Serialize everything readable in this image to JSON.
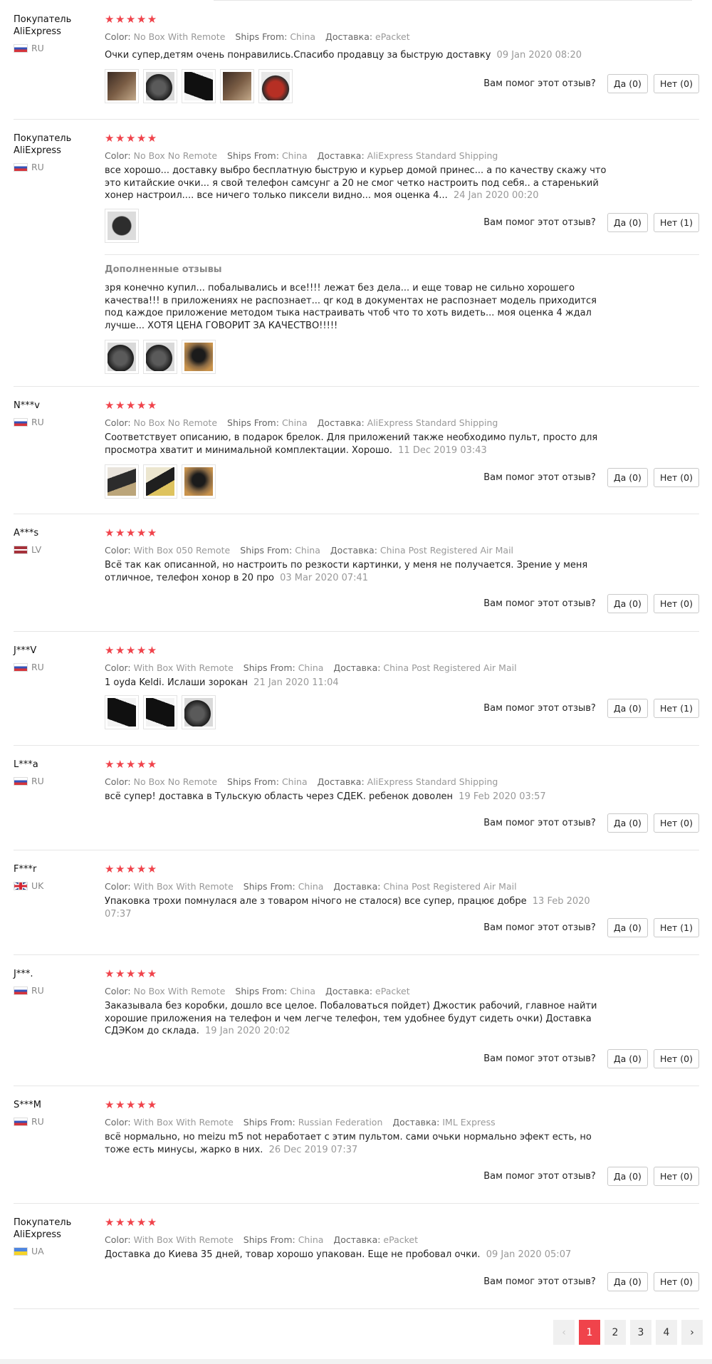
{
  "helpful_question": "Вам помог этот отзыв?",
  "labels": {
    "color": "Color:",
    "ships_from": "Ships From:",
    "delivery": "Доставка:"
  },
  "stars": "★★★★★",
  "reviews": [
    {
      "buyer": "Покупатель AliExpress",
      "country": "RU",
      "color": "No Box With Remote",
      "ships_from": "China",
      "delivery": "ePacket",
      "text": "Очки супер,детям очень понравились.Спасибо продавцу за быструю доставку",
      "date": "09 Jan 2020 08:20",
      "yes": "Да (0)",
      "no": "Нет (0)"
    },
    {
      "buyer": "Покупатель AliExpress",
      "country": "RU",
      "color": "No Box No Remote",
      "ships_from": "China",
      "delivery": "AliExpress Standard Shipping",
      "text": "все хорошо... доставку выбро бесплатную быструю и курьер домой принес... а по качеству скажу что это китайские очки... я свой телефон самсунг а 20 не смог четко настроить под себя.. а старенький хонер настроил.... все ничего только пиксели видно... моя оценка 4...",
      "date": "24 Jan 2020 00:20",
      "yes": "Да (0)",
      "no": "Нет (1)",
      "additional_title": "Дополненные отзывы",
      "additional_text": "зря конечно купил... побалывались и все!!!! лежат без дела... и еще товар не сильно хорошего качества!!! в приложениях не распознает... qr код в документах не распознает модель приходится под каждое приложение методом тыка настраивать чтоб что то хоть видеть... моя оценка 4 ждал лучше... ХОТЯ ЦЕНА ГОВОРИТ ЗА КАЧЕСТВО!!!!!"
    },
    {
      "buyer": "N***v",
      "country": "RU",
      "color": "No Box No Remote",
      "ships_from": "China",
      "delivery": "AliExpress Standard Shipping",
      "text": "Соответствует описанию, в подарок брелок. Для приложений также необходимо пульт, просто для просмотра хватит и минимальной комплектации. Хорошо.",
      "date": "11 Dec 2019 03:43",
      "yes": "Да (0)",
      "no": "Нет (0)"
    },
    {
      "buyer": "A***s",
      "country": "LV",
      "color": "With Box 050 Remote",
      "ships_from": "China",
      "delivery": "China Post Registered Air Mail",
      "text": "Всё так как описанной, но настроить по резкости картинки, у меня не получается. Зрение у меня отличное, телефон хонор в 20 про",
      "date": "03 Mar 2020 07:41",
      "yes": "Да (0)",
      "no": "Нет (0)"
    },
    {
      "buyer": "J***V",
      "country": "RU",
      "color": "With Box With Remote",
      "ships_from": "China",
      "delivery": "China Post Registered Air Mail",
      "text": "1 oyda Keldi. Ислаши зорокан",
      "date": "21 Jan 2020 11:04",
      "yes": "Да (0)",
      "no": "Нет (1)"
    },
    {
      "buyer": "L***a",
      "country": "RU",
      "color": "No Box No Remote",
      "ships_from": "China",
      "delivery": "AliExpress Standard Shipping",
      "text": "всё супер! доставка в Тульскую область через СДЕК. ребенок доволен",
      "date": "19 Feb 2020 03:57",
      "yes": "Да (0)",
      "no": "Нет (0)"
    },
    {
      "buyer": "F***r",
      "country": "UK",
      "color": "With Box With Remote",
      "ships_from": "China",
      "delivery": "China Post Registered Air Mail",
      "text": "Упаковка трохи помнулася але з товаром нічого не сталося) все супер, працює добре",
      "date": "13 Feb 2020 07:37",
      "yes": "Да (0)",
      "no": "Нет (1)"
    },
    {
      "buyer": "J***.",
      "country": "RU",
      "color": "No Box With Remote",
      "ships_from": "China",
      "delivery": "ePacket",
      "text": "Заказывала без коробки, дошло все целое. Побаловаться пойдет) Джостик рабочий, главное найти хорошие приложения на телефон и чем легче телефон, тем удобнее будут сидеть очки) Доставка СДЭКом до склада.",
      "date": "19 Jan 2020 20:02",
      "yes": "Да (0)",
      "no": "Нет (0)"
    },
    {
      "buyer": "S***M",
      "country": "RU",
      "color": "With Box With Remote",
      "ships_from": "Russian Federation",
      "delivery": "IML Express",
      "text": "всё нормально, но meizu m5 not неработает с этим пультом. сами очьки нормально эфект есть, но тоже есть минусы, жарко в них.",
      "date": "26 Dec 2019 07:37",
      "yes": "Да (0)",
      "no": "Нет (0)"
    },
    {
      "buyer": "Покупатель AliExpress",
      "country": "UA",
      "color": "With Box With Remote",
      "ships_from": "China",
      "delivery": "ePacket",
      "text": "Доставка до Киева 35 дней, товар хорошо упакован. Еще не пробовал очки.",
      "date": "09 Jan 2020 05:07",
      "yes": "Да (0)",
      "no": "Нет (0)"
    }
  ],
  "pagination": {
    "prev": "‹",
    "next": "›",
    "pages": [
      "1",
      "2",
      "3",
      "4"
    ],
    "current": "1"
  }
}
